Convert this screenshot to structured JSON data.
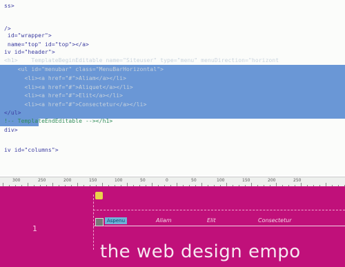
{
  "code_lines": [
    {
      "text": "ss>",
      "cls": "c-tag"
    },
    {
      "text": "",
      "cls": "c-tag"
    },
    {
      "text": "/>",
      "cls": "c-tag"
    },
    {
      "text": " id=\"wrapper\">",
      "cls": "c-tag"
    },
    {
      "text": " name=\"top\" id=\"top\"></a>",
      "cls": "c-tag"
    },
    {
      "text": "iv id=\"header\">",
      "cls": "c-tag"
    },
    {
      "text": "<h1>    TemplateBeginEditable name=\"Siteuser\" type=\"menu\" menuDirection=\"horizont",
      "cls": "c-faint"
    },
    {
      "text": "    <ul id=\"menubar\" class=\"MenuBarHorizontal\">",
      "cls": "c-faint"
    },
    {
      "text": "      <li><a href=\"#\">Aliam</a></li>",
      "cls": "c-faint"
    },
    {
      "text": "      <li><a href=\"#\">Aliquet</a></li>",
      "cls": "c-faint"
    },
    {
      "text": "      <li><a href=\"#\">Elit</a></li>",
      "cls": "c-faint"
    },
    {
      "text": "      <li><a href=\"#\">Consectetur</a></li>",
      "cls": "c-faint"
    },
    {
      "text": "</ul>",
      "cls": "c-tag"
    },
    {
      "text": "!-- TemplateEndEditable --></h1>",
      "cls": "c-com"
    },
    {
      "text": "div>",
      "cls": "c-tag"
    },
    {
      "text": "",
      "cls": "c-tag"
    },
    {
      "text": "iv id=\"columns\">",
      "cls": "c-tag"
    }
  ],
  "ruler": {
    "labels": [
      "300",
      "250",
      "200",
      "150",
      "100",
      "50",
      "0",
      "50",
      "100",
      "150",
      "200",
      "250"
    ]
  },
  "design": {
    "row_number": "1",
    "nav_current": "Aspenu",
    "nav_links": [
      "Aliam",
      "Elit",
      "Consectetur"
    ],
    "headline": "the web design empo"
  },
  "colors": {
    "selection": "#6a97d6",
    "design_bg": "#c0107a"
  }
}
